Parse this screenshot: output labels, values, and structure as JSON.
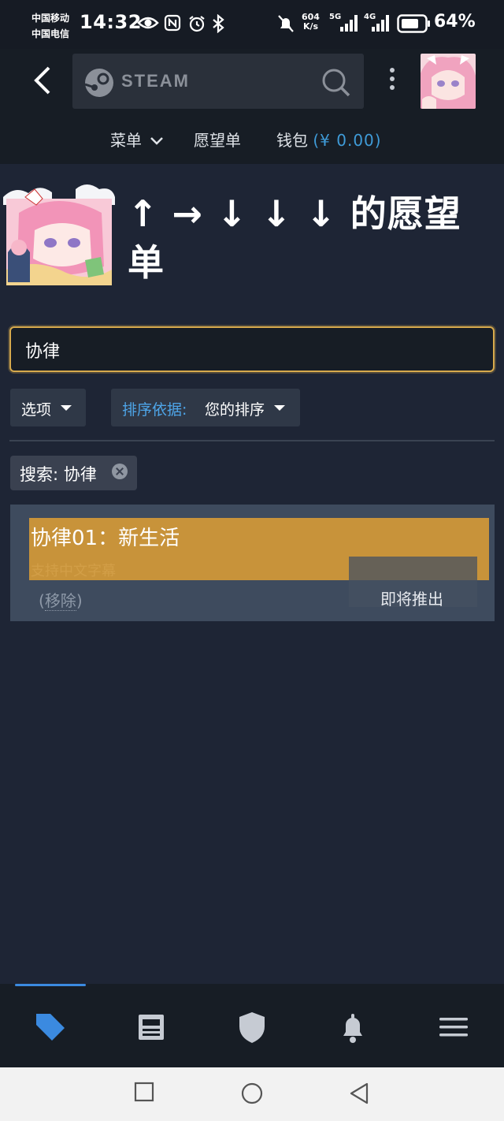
{
  "status_bar": {
    "carrier_1": "中国移动",
    "carrier_2": "中国电信",
    "time": "14:32",
    "net_speed_value": "604",
    "net_speed_unit": "K/s",
    "signal_1": "5G",
    "signal_2": "4G",
    "battery": "64%"
  },
  "header": {
    "search_brand": "STEAM",
    "nav": {
      "menu": "菜单",
      "wishlist": "愿望单",
      "wallet_label": "钱包",
      "wallet_value": "(¥ 0.00)"
    }
  },
  "profile": {
    "title": "↑ → ↓ ↓ ↓ 的愿望单"
  },
  "filters": {
    "search_value": "协律",
    "options_label": "选项",
    "sort_label": "排序依据:",
    "sort_value": "您的排序",
    "active_chip": "搜索: 协律"
  },
  "wishlist": {
    "items": [
      {
        "title": "协律01：新生活",
        "subtitle": "支持中文字幕",
        "remove_label": "移除",
        "release_status": "即将推出"
      }
    ]
  },
  "bottom_nav": {
    "active": "store",
    "items": [
      "store-tag-icon",
      "news-icon",
      "guard-shield-icon",
      "notifications-bell-icon",
      "menu-hamburger-icon"
    ]
  },
  "colors": {
    "background": "#1e2535",
    "header": "#171d25",
    "accent_blue": "#3f9bd8",
    "highlight_gold": "#c8933a",
    "search_border": "#d7aa4d"
  }
}
